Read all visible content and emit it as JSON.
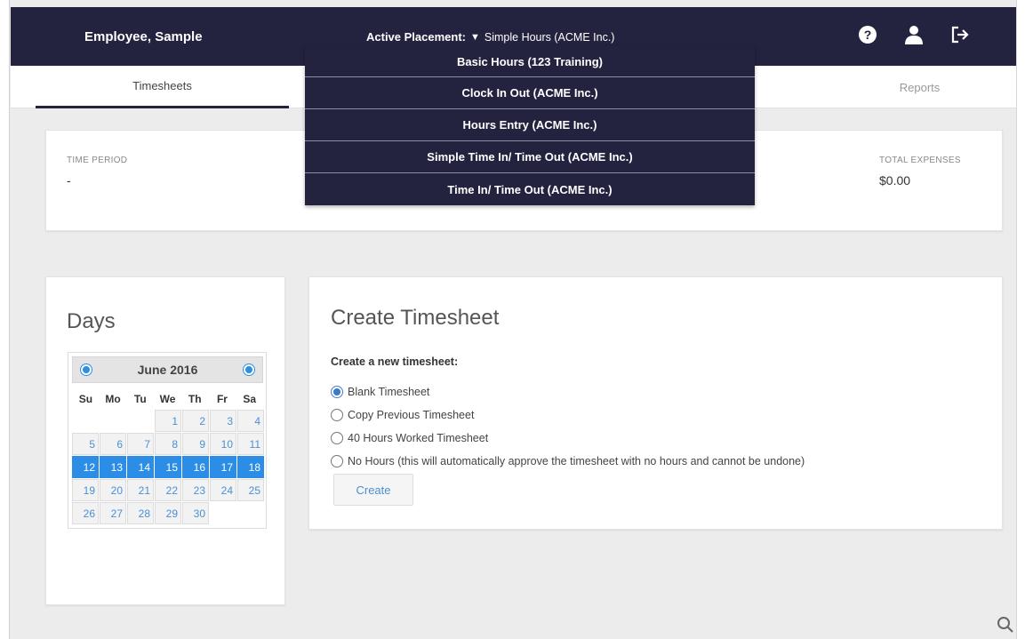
{
  "header": {
    "user_name": "Employee, Sample",
    "placement_label": "Active Placement:",
    "placement_value": "Simple Hours (ACME Inc.)",
    "icons": [
      "help-icon",
      "user-icon",
      "logout-icon"
    ]
  },
  "placement_menu": {
    "items": [
      {
        "label": "Basic Hours (123 Training)"
      },
      {
        "label": "Clock In Out (ACME Inc.)"
      },
      {
        "label": "Hours Entry (ACME Inc.)"
      },
      {
        "label": "Simple Time In/ Time Out (ACME Inc.)"
      },
      {
        "label": "Time In/ Time Out (ACME Inc.)"
      }
    ]
  },
  "tabs": {
    "timesheets": "Timesheets",
    "reports": "Reports"
  },
  "summary": {
    "time_period_label": "TIME PERIOD",
    "time_period_value": "-",
    "total_expenses_label": "TOTAL EXPENSES",
    "total_expenses_value": "$0.00"
  },
  "days": {
    "title": "Days",
    "calendar": {
      "month": "June 2016",
      "dows": [
        "Su",
        "Mo",
        "Tu",
        "We",
        "Th",
        "Fr",
        "Sa"
      ],
      "leading_blanks": 3,
      "days_in_month": 30,
      "selected_days": [
        12,
        13,
        14,
        15,
        16,
        17,
        18
      ]
    }
  },
  "create": {
    "title": "Create Timesheet",
    "subtitle": "Create a new timesheet:",
    "options": [
      {
        "label": "Blank Timesheet",
        "checked": true
      },
      {
        "label": "Copy Previous Timesheet",
        "checked": false
      },
      {
        "label": "40 Hours Worked Timesheet",
        "checked": false
      },
      {
        "label": "No Hours (this will automatically approve the timesheet with no hours and cannot be undone)",
        "checked": false
      }
    ],
    "button_label": "Create"
  },
  "colors": {
    "header_bg": "#23223f",
    "accent_blue": "#2b8de6"
  }
}
